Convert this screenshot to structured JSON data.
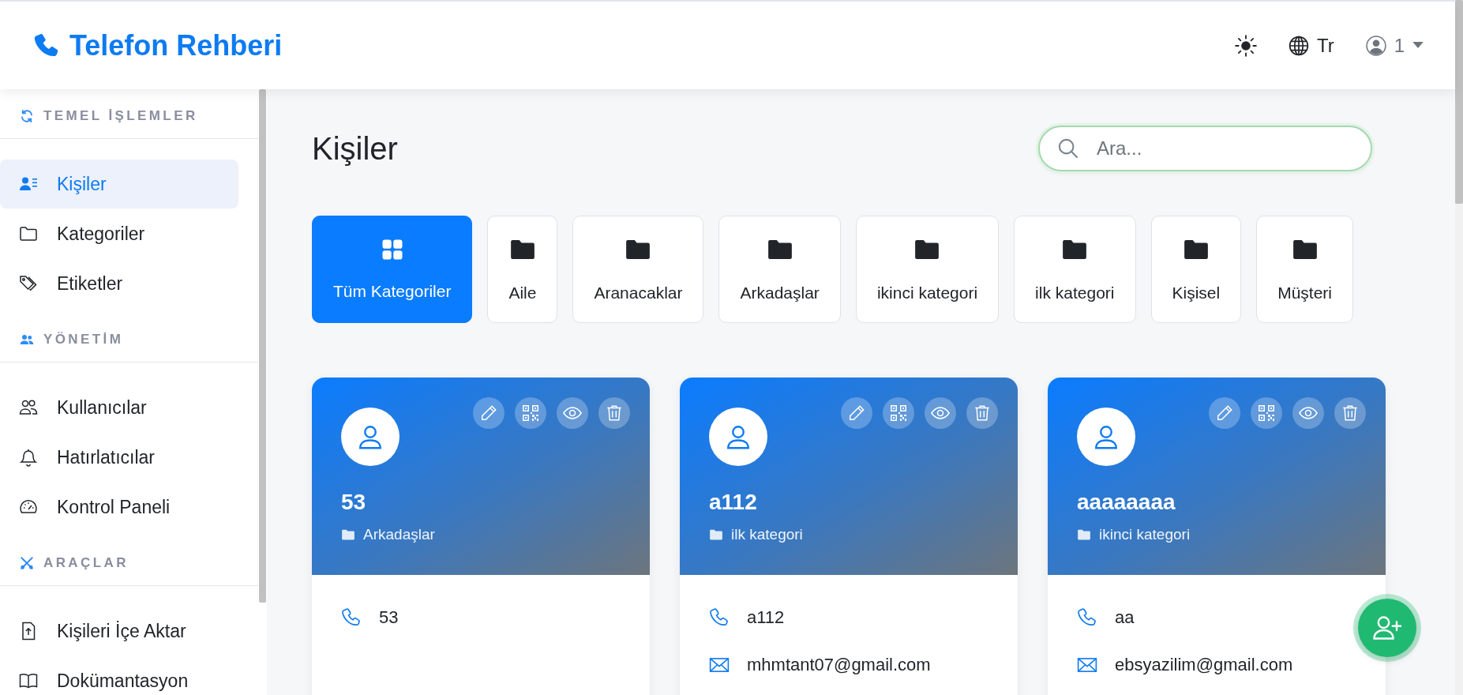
{
  "header": {
    "title": "Telefon Rehberi",
    "language": "Tr",
    "user": "1"
  },
  "sidebar": {
    "sections": [
      {
        "title": "TEMEL İŞLEMLER",
        "items": [
          {
            "label": "Kişiler",
            "selected": true
          },
          {
            "label": "Kategoriler",
            "selected": false
          },
          {
            "label": "Etiketler",
            "selected": false
          }
        ]
      },
      {
        "title": "YÖNETİM",
        "items": [
          {
            "label": "Kullanıcılar",
            "selected": false
          },
          {
            "label": "Hatırlatıcılar",
            "selected": false
          },
          {
            "label": "Kontrol Paneli",
            "selected": false
          }
        ]
      },
      {
        "title": "ARAÇLAR",
        "items": [
          {
            "label": "Kişileri İçe Aktar",
            "selected": false
          },
          {
            "label": "Dokümantasyon",
            "selected": false
          }
        ]
      }
    ]
  },
  "page": {
    "title": "Kişiler",
    "search": {
      "placeholder": "Ara..."
    }
  },
  "categories": [
    {
      "label": "Tüm Kategoriler",
      "kind": "all",
      "selected": true
    },
    {
      "label": "Aile",
      "kind": "category",
      "selected": false
    },
    {
      "label": "Aranacaklar",
      "kind": "category",
      "selected": false
    },
    {
      "label": "Arkadaşlar",
      "kind": "category",
      "selected": false
    },
    {
      "label": "ikinci kategori",
      "kind": "category",
      "selected": false
    },
    {
      "label": "ilk kategori",
      "kind": "category",
      "selected": false
    },
    {
      "label": "Kişisel",
      "kind": "category",
      "selected": false
    },
    {
      "label": "Müşteri",
      "kind": "category",
      "selected": false
    }
  ],
  "contacts": [
    {
      "name": "53",
      "category": "Arkadaşlar",
      "details": [
        {
          "kind": "phone",
          "text": "53"
        }
      ]
    },
    {
      "name": "a112",
      "category": "ilk kategori",
      "details": [
        {
          "kind": "phone",
          "text": "a112"
        },
        {
          "kind": "email",
          "text": "mhmtant07@gmail.com"
        }
      ]
    },
    {
      "name": "aaaaaaaa",
      "category": "ikinci kategori",
      "details": [
        {
          "kind": "phone",
          "text": "aa"
        },
        {
          "kind": "email",
          "text": "ebsyazilim@gmail.com"
        }
      ]
    }
  ]
}
